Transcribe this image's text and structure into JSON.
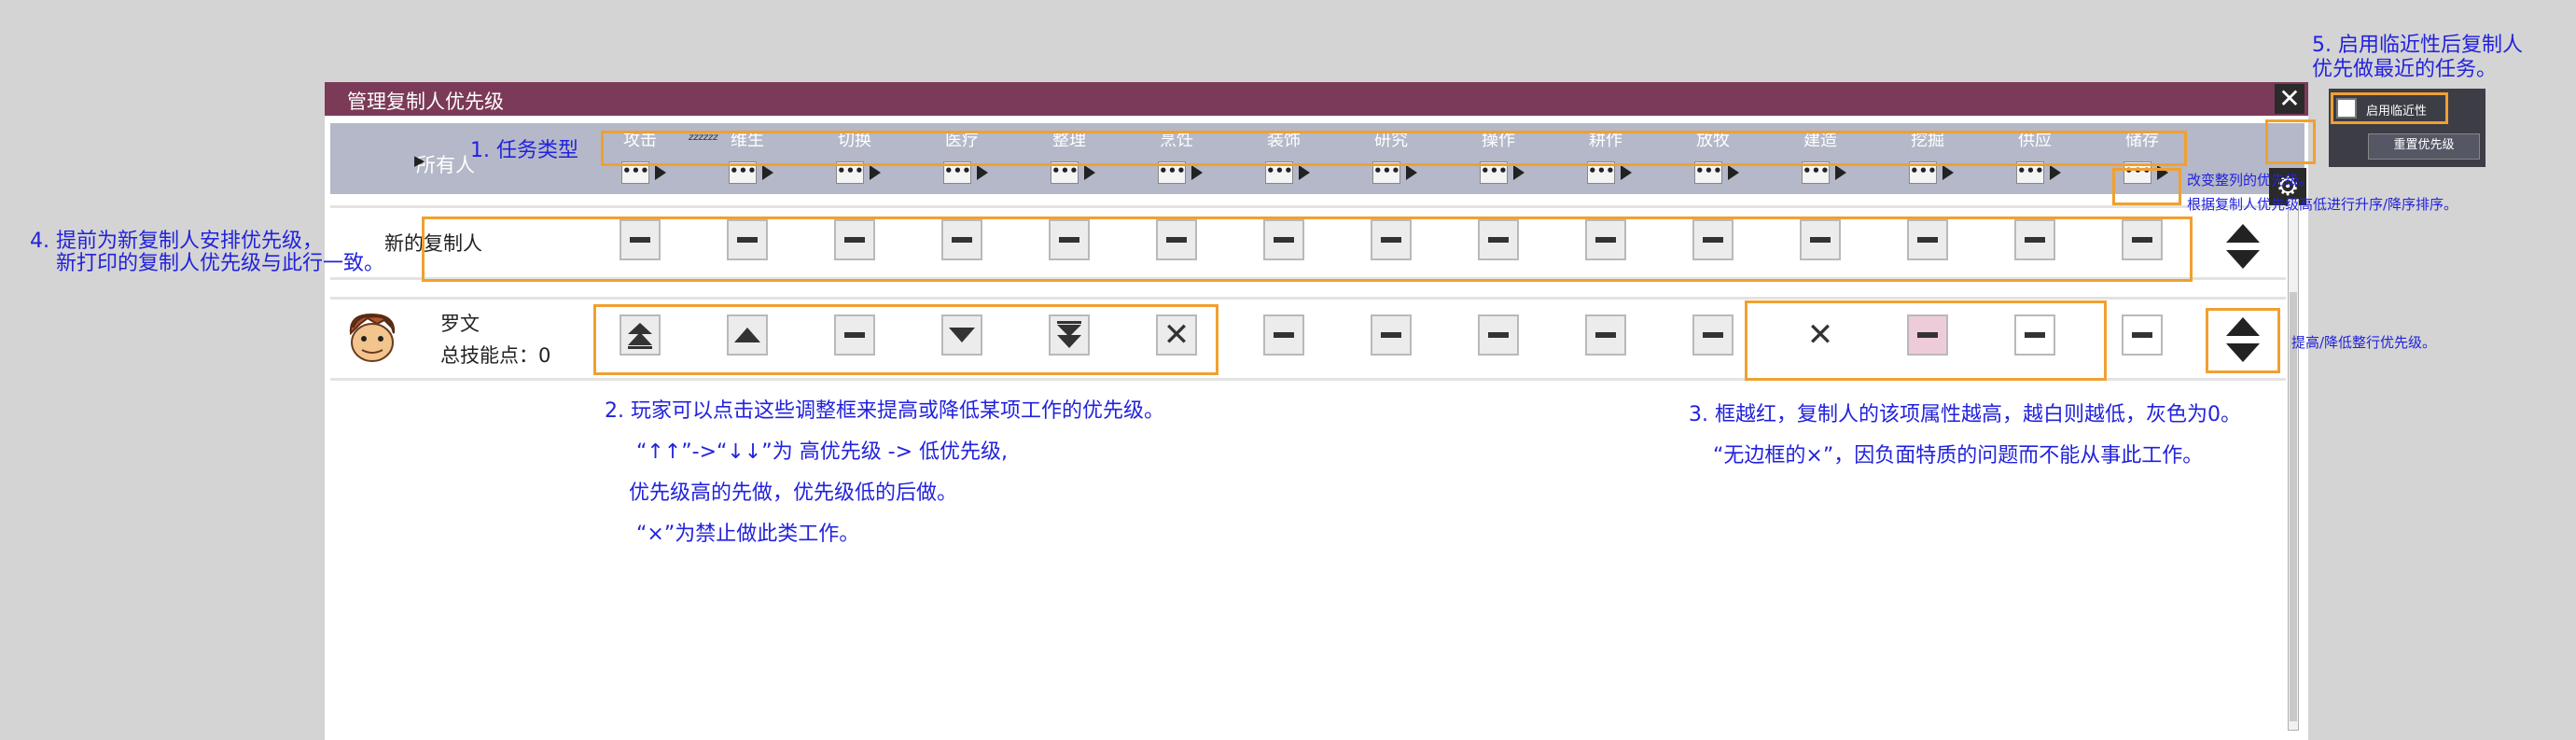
{
  "window": {
    "title": "管理复制人优先级",
    "close_label": "✕",
    "owner_label": "所有人",
    "owner_arrow": "▶",
    "gear_label": "⚙",
    "columns": [
      "攻击",
      "维生",
      "切换",
      "医疗",
      "整理",
      "烹饪",
      "装饰",
      "研究",
      "操作",
      "耕作",
      "放牧",
      "建造",
      "挖掘",
      "供应",
      "储存"
    ],
    "col_sort_label": "•••",
    "special_marker": "zzzzzz"
  },
  "rows": {
    "new_dupe": {
      "label": "新的复制人"
    },
    "dupe": {
      "name": "罗文",
      "skill_points": "总技能点：0",
      "priorities": [
        "very-high",
        "high",
        "neutral",
        "low",
        "very-low",
        "disabled",
        "neutral",
        "neutral",
        "neutral",
        "neutral",
        "neutral",
        "disabled-plain",
        "neutral-red",
        "neutral-white",
        "neutral-white"
      ]
    }
  },
  "popup": {
    "proximity_label": "启用临近性",
    "reset_label": "重置优先级"
  },
  "notes": {
    "n1": "1. 任务类型",
    "n2_line1": "2. 玩家可以点击这些调整框来提高或降低某项工作的优先级。",
    "n2_line2": "“↑↑”->“↓↓”为 高优先级 -> 低优先级,",
    "n2_line3": "优先级高的先做，优先级低的后做。",
    "n2_line4": "“×”为禁止做此类工作。",
    "n3_line1": "3. 框越红，复制人的该项属性越高，越白则越低，灰色为0。",
    "n3_line2": "“无边框的×”，因负面特质的问题而不能从事此工作。",
    "n4_line1": "4. 提前为新复制人安排优先级，",
    "n4_line2": "新打印的复制人优先级与此行一致。",
    "n5_line1": "5. 启用临近性后复制人",
    "n5_line2": "优先做最近的任务。",
    "col_sort_note1": "改变整列的优先级。",
    "col_sort_note2": "根据复制人优先级高低进行升序/降序排序。",
    "row_sort_note": "提高/降低整行优先级。"
  },
  "colors": {
    "title_bar": "#7b3a58",
    "header_bg": "#b4b8c8",
    "highlight": "#f0a030",
    "note_text": "#2222dd"
  }
}
